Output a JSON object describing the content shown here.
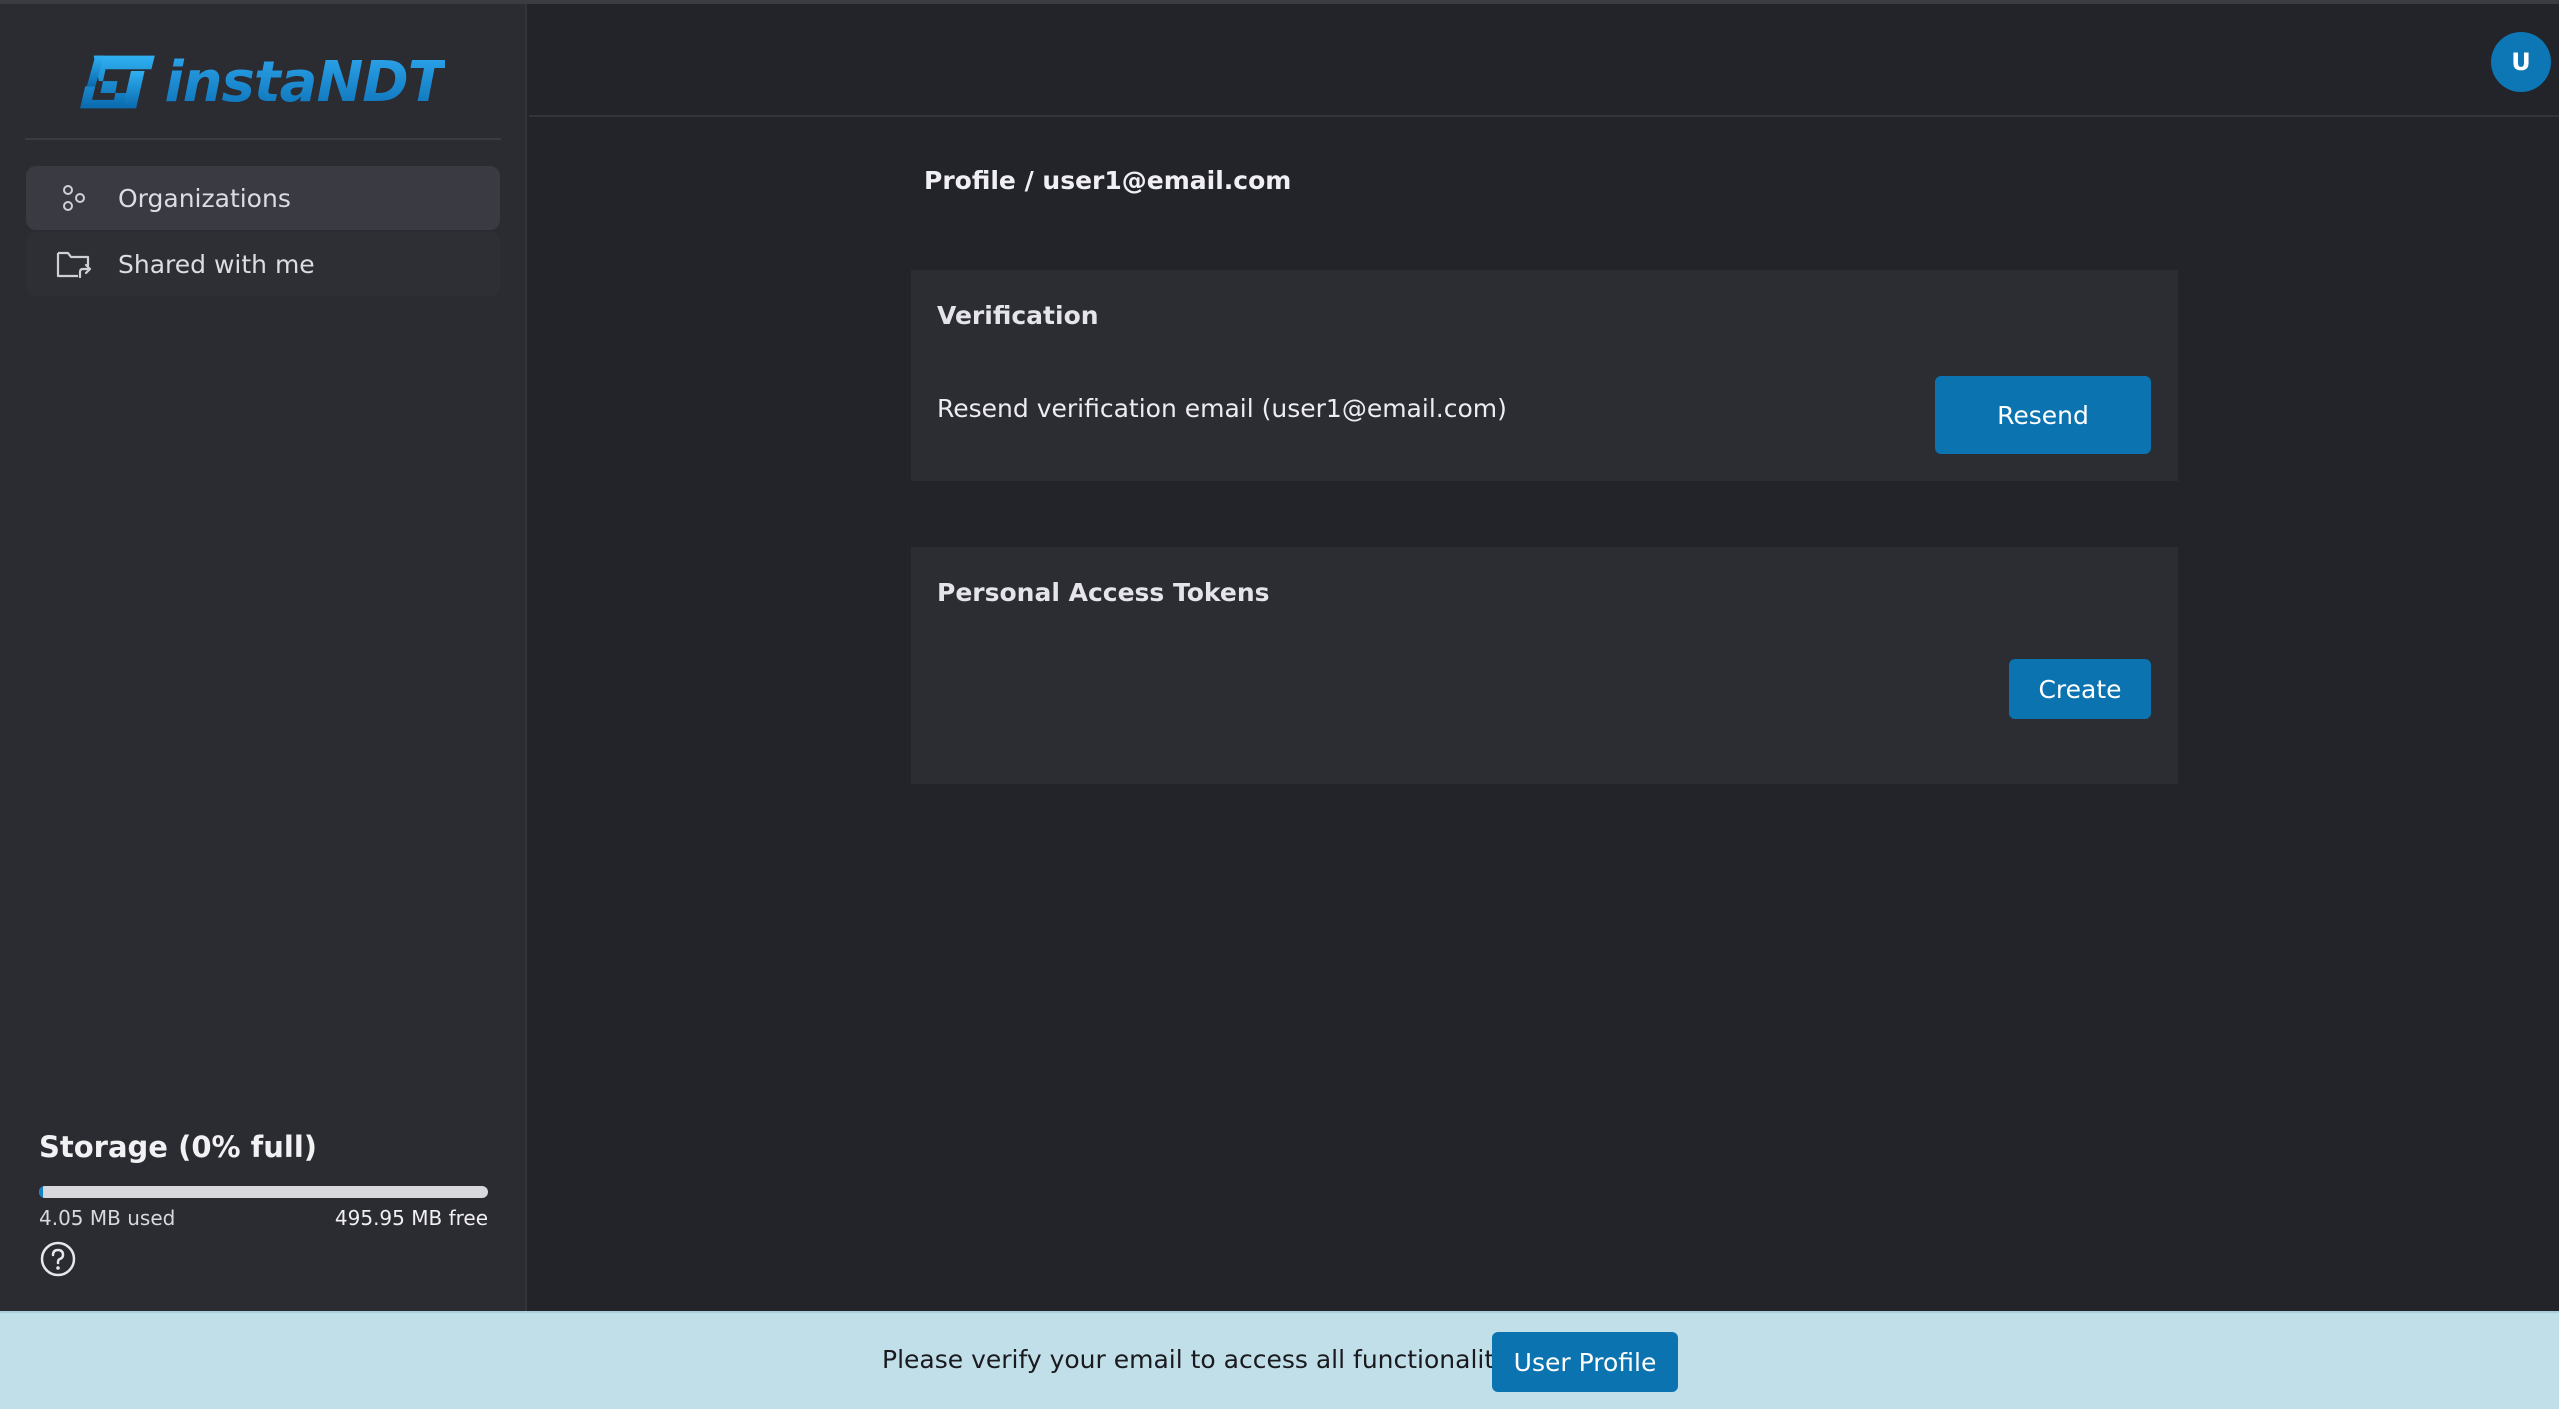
{
  "brand": {
    "logo_text": "instaNDT"
  },
  "sidebar": {
    "items": [
      {
        "label": "Organizations",
        "icon": "organizations-icon",
        "active": true
      },
      {
        "label": "Shared with me",
        "icon": "shared-folder-icon",
        "active": false
      }
    ],
    "storage": {
      "title": "Storage (0% full)",
      "used": "4.05 MB used",
      "free": "495.95 MB free",
      "fill_fraction": 0.008
    }
  },
  "header": {
    "avatar_initial": "U"
  },
  "main": {
    "breadcrumb": "Profile / user1@email.com",
    "verification": {
      "title": "Verification",
      "text": "Resend verification email (user1@email.com)",
      "button_label": "Resend"
    },
    "tokens": {
      "title": "Personal Access Tokens",
      "button_label": "Create"
    }
  },
  "banner": {
    "message": "Please verify your email to access all functionalities",
    "button_label": "User Profile"
  },
  "colors": {
    "accent": "#0a73b0",
    "background": "#23232a",
    "sidebar": "#2b2b32",
    "card": "#2c2c33",
    "banner": "#c0dfe9"
  }
}
